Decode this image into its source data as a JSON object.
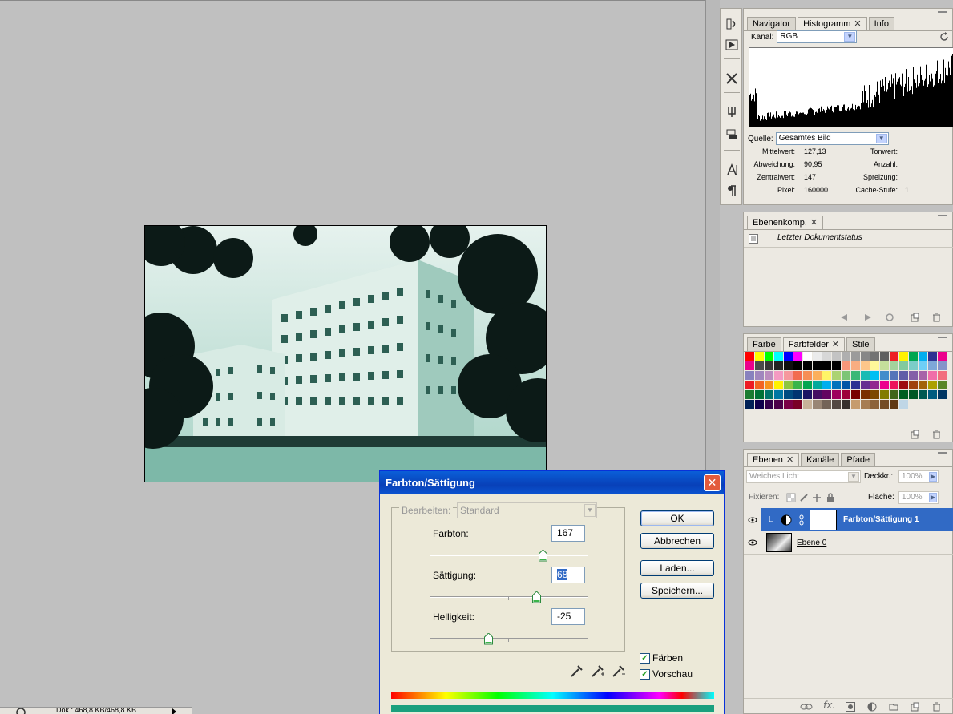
{
  "status_bar": {
    "doc_size": "Dok.: 468,8 KB/468,8 KB"
  },
  "histogram_panel": {
    "tabs": [
      {
        "label": "Navigator",
        "active": false,
        "closable": false
      },
      {
        "label": "Histogramm",
        "active": true,
        "closable": true
      },
      {
        "label": "Info",
        "active": false,
        "closable": false
      }
    ],
    "channel_label": "Kanal:",
    "channel_value": "RGB",
    "source_label": "Quelle:",
    "source_value": "Gesamtes Bild",
    "stats_left": [
      {
        "label": "Mittelwert:",
        "value": "127,13"
      },
      {
        "label": "Abweichung:",
        "value": "90,95"
      },
      {
        "label": "Zentralwert:",
        "value": "147"
      },
      {
        "label": "Pixel:",
        "value": "160000"
      }
    ],
    "stats_right": [
      {
        "label": "Tonwert:",
        "value": ""
      },
      {
        "label": "Anzahl:",
        "value": ""
      },
      {
        "label": "Spreizung:",
        "value": ""
      },
      {
        "label": "Cache-Stufe:",
        "value": "1"
      }
    ]
  },
  "comps_panel": {
    "tab": "Ebenenkomp.",
    "item": "Letzter Dokumentstatus"
  },
  "swatches_panel": {
    "tabs": [
      {
        "label": "Farbe",
        "active": false,
        "closable": false
      },
      {
        "label": "Farbfelder",
        "active": true,
        "closable": true
      },
      {
        "label": "Stile",
        "active": false,
        "closable": false
      }
    ],
    "colors": [
      "#ff0000",
      "#ffff00",
      "#00ff00",
      "#00ffff",
      "#0000ff",
      "#ff00ff",
      "#ffffff",
      "#ebebeb",
      "#d7d7d7",
      "#c3c3c3",
      "#afafaf",
      "#9b9b9b",
      "#878787",
      "#737373",
      "#5f5f5f",
      "#ed1c24",
      "#fff200",
      "#00a651",
      "#00aeef",
      "#2e3192",
      "#ec008c",
      "#ec008c",
      "#4b4b4b",
      "#373737",
      "#232323",
      "#0f0f0f",
      "#000000",
      "#000000",
      "#000000",
      "#000000",
      "#000000",
      "#f7977a",
      "#f9ad81",
      "#fdc68a",
      "#fff79a",
      "#c4df9b",
      "#a3d39c",
      "#82ca9d",
      "#7bcdc8",
      "#6ecff6",
      "#7ea7d8",
      "#8493ca",
      "#8882be",
      "#a187be",
      "#bc8dbf",
      "#f49ac2",
      "#f6989d",
      "#f26c4f",
      "#f68e55",
      "#fbaf5c",
      "#fff467",
      "#acd372",
      "#7cc576",
      "#3bb878",
      "#1abbb4",
      "#00bff3",
      "#438ccb",
      "#5574b9",
      "#605ca8",
      "#855fa8",
      "#a763a8",
      "#f06ea9",
      "#f26d7d",
      "#ed1c24",
      "#f26522",
      "#f7941d",
      "#fff200",
      "#8dc63f",
      "#39b54a",
      "#00a651",
      "#00a99d",
      "#00aeef",
      "#0072bc",
      "#0054a6",
      "#2e3192",
      "#662d91",
      "#92278f",
      "#ec008c",
      "#ed145b",
      "#9e0b0f",
      "#a0410d",
      "#a36209",
      "#aba000",
      "#598527",
      "#1a7b30",
      "#007236",
      "#00746b",
      "#0076a3",
      "#004b80",
      "#003471",
      "#1b1464",
      "#440e62",
      "#630460",
      "#9e005d",
      "#9e0039",
      "#790000",
      "#7b2e00",
      "#7d4900",
      "#827b00",
      "#406618",
      "#005e20",
      "#005826",
      "#005952",
      "#005b7f",
      "#003663",
      "#002157",
      "#0d004c",
      "#32004b",
      "#4b0049",
      "#7b0046",
      "#7a0026",
      "#c7b299",
      "#998675",
      "#736357",
      "#534741",
      "#37302d",
      "#c69c6d",
      "#a67c52",
      "#8c6239",
      "#754c24",
      "#603913",
      "#bfd6e6"
    ],
    "visible_count": 128
  },
  "layers_panel": {
    "tabs": [
      {
        "label": "Ebenen",
        "active": true,
        "closable": true
      },
      {
        "label": "Kanäle",
        "active": false,
        "closable": false
      },
      {
        "label": "Pfade",
        "active": false,
        "closable": false
      }
    ],
    "blend_mode": "Weiches Licht",
    "opacity_label": "Deckkr.:",
    "opacity_value": "100%",
    "lock_label": "Fixieren:",
    "fill_label": "Fläche:",
    "fill_value": "100%",
    "layers": [
      {
        "name": "Farbton/Sättigung 1",
        "selected": true
      },
      {
        "name": "Ebene 0",
        "selected": false
      }
    ]
  },
  "dialog": {
    "title": "Farbton/Sättigung",
    "edit_label": "Bearbeiten:",
    "edit_value": "Standard",
    "hue_label": "Farbton:",
    "hue_value": "167",
    "saturation_label": "Sättigung:",
    "saturation_value": "68",
    "lightness_label": "Helligkeit:",
    "lightness_value": "-25",
    "ok": "OK",
    "cancel": "Abbrechen",
    "load": "Laden...",
    "save": "Speichern...",
    "colorize_label": "Färben",
    "colorize_checked": true,
    "preview_label": "Vorschau",
    "preview_checked": true,
    "hue_fraction": 0.72,
    "saturation_fraction": 0.68,
    "lightness_fraction": 0.375,
    "result_color": "#1aa07e"
  }
}
